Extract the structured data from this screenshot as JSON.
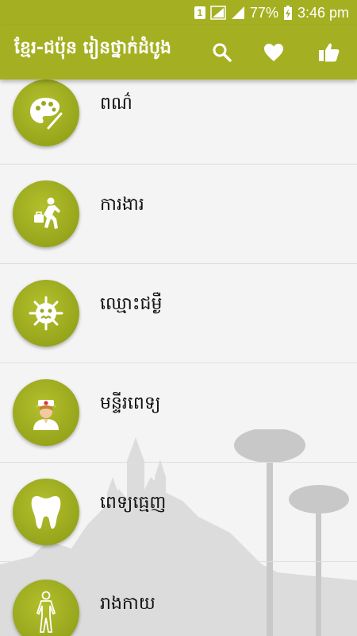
{
  "status_bar": {
    "sim_label": "1",
    "battery": "77%",
    "time": "3:46 pm"
  },
  "toolbar": {
    "title": "ខ្មែរ-ជប៉ុន រៀនថ្នាក់ដំបូង",
    "search_icon": "search-icon",
    "favorite_icon": "heart-icon",
    "like_icon": "thumbs-up-icon"
  },
  "colors": {
    "accent": "#a4b022",
    "circle": "#9aa81f"
  },
  "categories": [
    {
      "label": "ពណ៌",
      "icon": "palette-icon"
    },
    {
      "label": "ការងារ",
      "icon": "worker-running-icon"
    },
    {
      "label": "ឈ្មោះជម្ងឺ",
      "icon": "virus-icon"
    },
    {
      "label": "មន្ទីរពេទ្យ",
      "icon": "nurse-icon"
    },
    {
      "label": "ពេទ្យធ្មេញ",
      "icon": "tooth-icon"
    },
    {
      "label": "រាងកាយ",
      "icon": "human-body-icon"
    }
  ]
}
